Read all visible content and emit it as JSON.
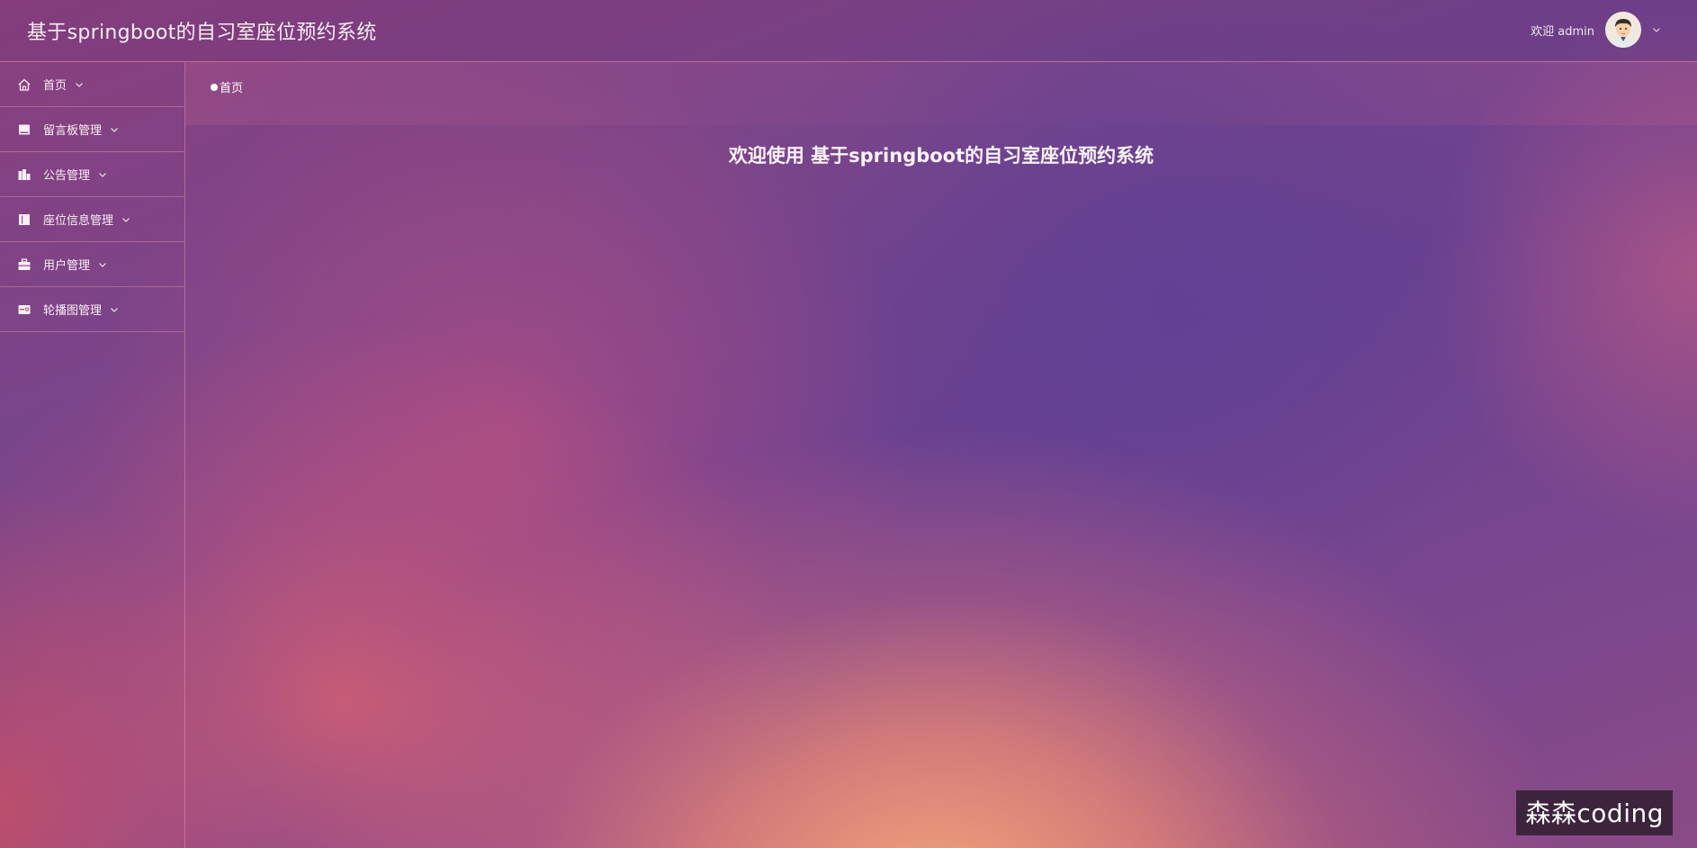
{
  "header": {
    "app_title": "基于springboot的自习室座位预约系统",
    "welcome_text": "欢迎 admin"
  },
  "sidebar": {
    "items": [
      {
        "label": "首页",
        "icon": "home-icon"
      },
      {
        "label": "留言板管理",
        "icon": "message-board-icon"
      },
      {
        "label": "公告管理",
        "icon": "announcement-icon"
      },
      {
        "label": "座位信息管理",
        "icon": "seat-info-icon"
      },
      {
        "label": "用户管理",
        "icon": "user-management-icon"
      },
      {
        "label": "轮播图管理",
        "icon": "carousel-icon"
      }
    ]
  },
  "breadcrumb": {
    "current": "首页"
  },
  "main": {
    "welcome_heading": "欢迎使用 基于springboot的自习室座位预约系统"
  },
  "watermark": {
    "text": "森森coding"
  },
  "colors": {
    "background_top": "#7a4589",
    "background_glow": "#f8aa78",
    "divider": "#ff96aa",
    "text": "#ffffff"
  }
}
